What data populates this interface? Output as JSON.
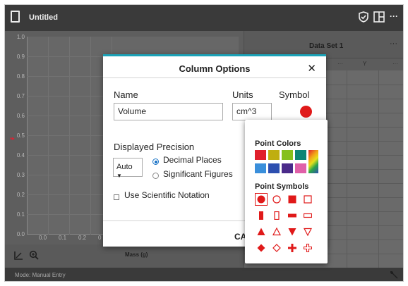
{
  "app": {
    "title": "Untitled"
  },
  "toolbar": {
    "menu_icon": "ellipsis-icon"
  },
  "graph": {
    "y_ticks": [
      "1.0",
      "0.9",
      "0.8",
      "0.7",
      "0.6",
      "0.5",
      "0.4",
      "0.3",
      "0.2",
      "0.1",
      "0.0"
    ],
    "x_ticks": [
      "0.0",
      "0.1",
      "0.2",
      "0"
    ],
    "x_label": "Mass (g)"
  },
  "table": {
    "data_set_title": "Data Set 1",
    "menu": "···",
    "columns": [
      "···",
      "Y",
      "···"
    ]
  },
  "status": {
    "mode": "Mode: Manual Entry"
  },
  "dialog": {
    "title": "Column Options",
    "close": "✕",
    "name_label": "Name",
    "name_value": "Volume",
    "units_label": "Units",
    "units_value": "cm^3",
    "symbol_label": "Symbol",
    "symbol_color": "#e01919",
    "precision_label": "Displayed Precision",
    "precision_select": "Auto",
    "precision_options": [
      "Decimal Places",
      "Significant Figures"
    ],
    "precision_selected": "Decimal Places",
    "scientific_label": "Use Scientific Notation",
    "cancel_label": "CA"
  },
  "popup": {
    "colors_title": "Point Colors",
    "colors": [
      "#e0202c",
      "#bfae10",
      "#86c01c",
      "#0d8576",
      "rainbow",
      "#3a8fdb",
      "#2d4fb0",
      "#4a2a8a",
      "#e060a8",
      "rainbow2"
    ],
    "symbols_title": "Point Symbols",
    "symbols": [
      "filled-circle",
      "open-circle",
      "filled-square",
      "open-square",
      "filled-tall-rect",
      "open-tall-rect",
      "filled-wide-rect",
      "open-wide-rect",
      "filled-triangle-up",
      "open-triangle-up",
      "filled-triangle-down",
      "open-triangle-down",
      "filled-diamond",
      "open-diamond",
      "filled-plus",
      "open-plus"
    ],
    "selected_symbol": "filled-circle"
  }
}
